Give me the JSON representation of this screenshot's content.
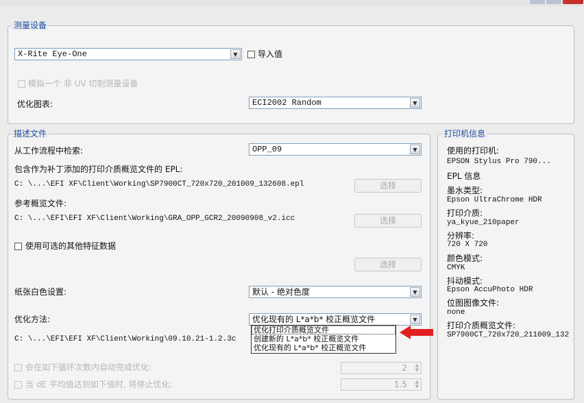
{
  "colors": {
    "accent": "#1c4fa3",
    "arrow": "#e02020"
  },
  "measure": {
    "title": "测量设备",
    "device": "X-Rite Eye-One",
    "import_label": "导入值",
    "simulate_label": "模拟一个 非 UV 切割测量设备",
    "chart_label": "优化图表:",
    "chart_value": "ECI2002 Random"
  },
  "profile": {
    "title": "描述文件",
    "workflow_label": "从工作流程中检索:",
    "workflow_value": "OPP_09",
    "epl_label": "包含作为补丁添加的打印介质概览文件的 EPL:",
    "epl_path": "C: \\...\\EFI XF\\Client\\Working\\SP7900CT_720x720_201009_132608.epl",
    "choose1": "选择",
    "ref_label": "参考概览文件:",
    "ref_path": "C: \\...\\EFI\\EFI XF\\Client\\Working\\GRA_OPP_GCR2_20090908_v2.icc",
    "choose2": "选择",
    "optional_label": "使用可选的其他特征数据",
    "choose3": "选择",
    "white_label": "纸张白色设置:",
    "white_value": "默认 - 绝对色度",
    "method_label": "优化方法:",
    "method_value": "优化现有的 L*a*b* 校正概览文件",
    "method_options": [
      "优化打印介质概览文件",
      "创建新的 L*a*b* 校正概览文件",
      "优化现有的 L*a*b* 校正概览文件"
    ],
    "method_path": "C: \\...\\EFI\\EFI XF\\Client\\Working\\09.10.21-1.2.3c",
    "loop_label": "会在如下循环次数内自动完成优化:",
    "loop_value": "2",
    "de_label": "当 dE 平均值达到如下值时, 将停止优化:",
    "de_value": "1.5"
  },
  "printer": {
    "title": "打印机信息",
    "items": [
      {
        "label": "使用的打印机:",
        "value": "EPSON Stylus Pro 790..."
      },
      {
        "label": "EPL 信息",
        "value": ""
      },
      {
        "label": "墨水类型:",
        "value": "Epson UltraChrome HDR"
      },
      {
        "label": "打印介质:",
        "value": "ya_kyue_210paper"
      },
      {
        "label": "分辨率:",
        "value": "720 X 720"
      },
      {
        "label": "颜色模式:",
        "value": "CMYK"
      },
      {
        "label": "抖动模式:",
        "value": "Epson AccuPhoto HDR"
      },
      {
        "label": "位图图像文件:",
        "value": "none"
      },
      {
        "label": "打印介质概览文件:",
        "value": "SP7900CT_720x720_211009_132"
      }
    ]
  }
}
